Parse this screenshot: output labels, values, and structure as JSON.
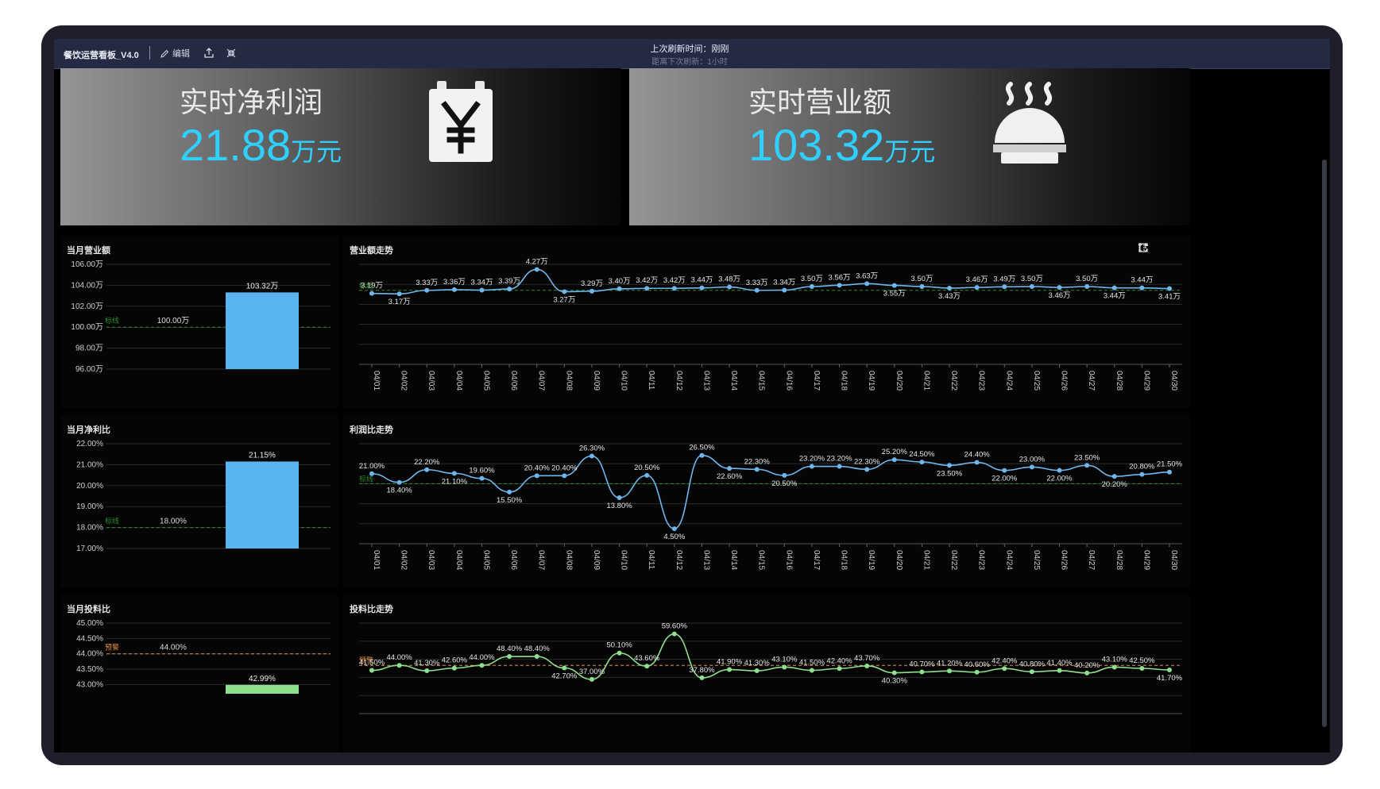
{
  "app": {
    "title": "餐饮运营看板_V4.0",
    "edit_label": "编辑",
    "refresh_line1": "上次刷新时间：刚刚",
    "refresh_line2": "距离下次刷新：1小时"
  },
  "kpis": [
    {
      "title": "实时净利润",
      "value": "21.88",
      "unit": "万元",
      "icon": "yuan-calendar-icon"
    },
    {
      "title": "实时营业额",
      "value": "103.32",
      "unit": "万元",
      "icon": "cloche-steam-icon"
    }
  ],
  "colors": {
    "accent": "#2fd0ff",
    "bar_blue": "#5ab4f0",
    "line_blue": "#6fb6ec",
    "line_green": "#8ee08e",
    "target_green": "#2e8b2e",
    "warn_orange": "#e0904a"
  },
  "panels": {
    "revenue_month": {
      "title": "当月营业额"
    },
    "revenue_trend": {
      "title": "营业额走势"
    },
    "profit_month": {
      "title": "当月净利比"
    },
    "profit_trend": {
      "title": "利润比走势"
    },
    "feed_month": {
      "title": "当月投料比"
    },
    "feed_trend": {
      "title": "投料比走势"
    }
  },
  "chart_data": [
    {
      "id": "revenue_month",
      "type": "bar",
      "title": "当月营业额",
      "ticks": [
        "106.00万",
        "104.00万",
        "102.00万",
        "100.00万",
        "98.00万",
        "96.00万"
      ],
      "ylim": [
        96,
        106
      ],
      "values": [
        103.32
      ],
      "value_labels": [
        "103.32万"
      ],
      "reference": {
        "label": "标线",
        "value": 100,
        "value_label": "100.00万",
        "style": "green-dashed"
      }
    },
    {
      "id": "revenue_trend",
      "type": "line",
      "title": "营业额走势",
      "categories": [
        "04/01",
        "04/02",
        "04/03",
        "04/04",
        "04/05",
        "04/06",
        "04/07",
        "04/08",
        "04/09",
        "04/10",
        "04/11",
        "04/12",
        "04/13",
        "04/14",
        "04/15",
        "04/16",
        "04/17",
        "04/18",
        "04/19",
        "04/20",
        "04/21",
        "04/22",
        "04/23",
        "04/24",
        "04/25",
        "04/26",
        "04/27",
        "04/28",
        "04/29",
        "04/30"
      ],
      "values": [
        3.19,
        3.17,
        3.33,
        3.36,
        3.34,
        3.39,
        4.27,
        3.27,
        3.29,
        3.4,
        3.42,
        3.42,
        3.44,
        3.48,
        3.33,
        3.34,
        3.5,
        3.56,
        3.63,
        3.55,
        3.5,
        3.43,
        3.46,
        3.49,
        3.5,
        3.46,
        3.5,
        3.44,
        3.44,
        3.41
      ],
      "labels": [
        "3.19万",
        "3.17万",
        "3.33万",
        "3.36万",
        "3.34万",
        "3.39万",
        "4.27万",
        "3.27万",
        "3.29万",
        "3.40万",
        "3.42万",
        "3.42万",
        "3.44万",
        "3.48万",
        "3.33万",
        "3.34万",
        "3.50万",
        "3.56万",
        "3.63万",
        "3.55万",
        "3.50万",
        "3.43万",
        "3.46万",
        "3.49万",
        "3.50万",
        "3.46万",
        "3.50万",
        "3.44万",
        "3.44万",
        "3.41万"
      ],
      "reference": {
        "label": "标线",
        "value": 3.33,
        "style": "green-dashed"
      },
      "ylim": [
        0,
        4.5
      ],
      "grid": true
    },
    {
      "id": "profit_month",
      "type": "bar",
      "title": "当月净利比",
      "ticks": [
        "22.00%",
        "21.00%",
        "20.00%",
        "19.00%",
        "18.00%",
        "17.00%"
      ],
      "ylim": [
        17,
        22
      ],
      "values": [
        21.15
      ],
      "value_labels": [
        "21.15%"
      ],
      "reference": {
        "label": "标线",
        "value": 18,
        "value_label": "18.00%",
        "style": "green-dashed"
      }
    },
    {
      "id": "profit_trend",
      "type": "line",
      "title": "利润比走势",
      "categories": [
        "04/01",
        "04/02",
        "04/03",
        "04/04",
        "04/05",
        "04/06",
        "04/07",
        "04/08",
        "04/09",
        "04/10",
        "04/11",
        "04/12",
        "04/13",
        "04/14",
        "04/15",
        "04/16",
        "04/17",
        "04/18",
        "04/19",
        "04/20",
        "04/21",
        "04/22",
        "04/23",
        "04/24",
        "04/25",
        "04/26",
        "04/27",
        "04/28",
        "04/29",
        "04/30"
      ],
      "values": [
        21.0,
        18.4,
        22.2,
        21.1,
        19.6,
        15.5,
        20.4,
        20.4,
        26.3,
        13.8,
        20.5,
        4.5,
        26.5,
        22.6,
        22.3,
        20.5,
        23.2,
        23.2,
        22.3,
        25.2,
        24.5,
        23.5,
        24.4,
        22.0,
        23.0,
        22.0,
        23.5,
        20.2,
        20.8,
        21.5
      ],
      "labels": [
        "21.00%",
        "18.40%",
        "22.20%",
        "21.10%",
        "19.60%",
        "15.50%",
        "20.40%",
        "20.40%",
        "26.30%",
        "13.80%",
        "20.50%",
        "4.50%",
        "26.50%",
        "22.60%",
        "22.30%",
        "20.50%",
        "23.20%",
        "23.20%",
        "22.30%",
        "25.20%",
        "24.50%",
        "23.50%",
        "24.40%",
        "22.00%",
        "23.00%",
        "22.00%",
        "23.50%",
        "20.20%",
        "20.80%",
        "21.50%"
      ],
      "reference": {
        "label": "标线",
        "value": 18,
        "style": "green-dashed"
      },
      "ylim": [
        0,
        30
      ],
      "grid": true
    },
    {
      "id": "feed_month",
      "type": "bar",
      "title": "当月投料比",
      "ticks": [
        "45.00%",
        "44.50%",
        "44.00%",
        "43.50%",
        "43.00%"
      ],
      "ylim": [
        42.7,
        45
      ],
      "values": [
        42.99
      ],
      "value_labels": [
        "42.99%"
      ],
      "reference": {
        "label": "预警",
        "value": 44,
        "value_label": "44.00%",
        "style": "orange-dashed"
      }
    },
    {
      "id": "feed_trend",
      "type": "line",
      "title": "投料比走势",
      "categories": [
        "04/01",
        "04/02",
        "04/03",
        "04/04",
        "04/05",
        "04/06",
        "04/07",
        "04/08",
        "04/09",
        "04/10",
        "04/11",
        "04/12",
        "04/13",
        "04/14",
        "04/15",
        "04/16",
        "04/17",
        "04/18",
        "04/19",
        "04/20",
        "04/21",
        "04/22",
        "04/23",
        "04/24",
        "04/25",
        "04/26",
        "04/27",
        "04/28",
        "04/29",
        "04/30"
      ],
      "values": [
        41.5,
        44.0,
        41.3,
        42.6,
        44.0,
        48.4,
        48.4,
        42.7,
        37.0,
        50.1,
        43.6,
        59.6,
        37.8,
        41.9,
        41.3,
        43.1,
        41.5,
        42.4,
        43.7,
        40.3,
        40.7,
        41.2,
        40.6,
        42.4,
        40.8,
        41.4,
        40.2,
        43.1,
        42.5,
        41.7
      ],
      "labels": [
        "41.50%",
        "44.00%",
        "41.30%",
        "42.60%",
        "44.00%",
        "48.40%",
        "48.40%",
        "42.70%",
        "37.00%",
        "50.10%",
        "43.60%",
        "59.60%",
        "37.80%",
        "41.90%",
        "41.30%",
        "43.10%",
        "41.50%",
        "42.40%",
        "43.70%",
        "40.30%",
        "40.70%",
        "41.20%",
        "40.60%",
        "42.40%",
        "40.80%",
        "41.40%",
        "40.20%",
        "43.10%",
        "42.50%",
        "41.70%"
      ],
      "reference": {
        "label": "预警",
        "value": 44,
        "style": "orange-dashed"
      },
      "ylim": [
        20,
        65
      ],
      "grid": true
    }
  ]
}
